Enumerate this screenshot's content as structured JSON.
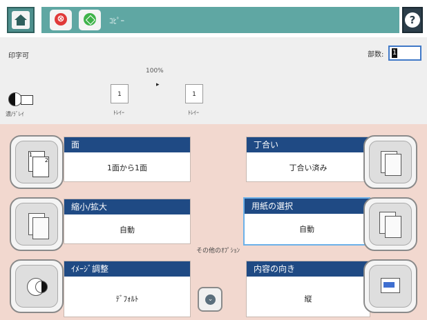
{
  "header": {
    "title": "ｺﾋﾟｰ",
    "home_icon": "home-icon",
    "stop_icon": "stop-icon",
    "start_icon": "start-icon",
    "help_icon": "help-icon",
    "stop_symbol": "⊗",
    "help_symbol": "?",
    "accent": "#5fa7a3"
  },
  "info": {
    "status": "印字可",
    "copies_label": "部数:",
    "copies_value": "1",
    "zoom": "100%",
    "original_page": "1",
    "output_page": "1",
    "original_tray": "ﾄﾚｲｰ",
    "output_tray": "ﾄﾚｲｰ",
    "darkness_label": "濃/ﾗﾞﾚｲ"
  },
  "options": {
    "sides": {
      "label": "面",
      "value": "1面から1面"
    },
    "collate": {
      "label": "丁合い",
      "value": "丁合い済み"
    },
    "reduce_enlarge": {
      "label": "縮小/拡大",
      "value": "自動"
    },
    "paper_select": {
      "label": "用紙の選択",
      "value": "自動"
    },
    "image_adjust": {
      "label": "ｲﾒｰｼﾞ調整",
      "value": "ﾃﾞﾌｫﾙﾄ"
    },
    "orientation": {
      "label": "内容の向き",
      "value": "縦"
    },
    "other_options_label": "その他のｵﾌﾟｼｮﾝ"
  }
}
